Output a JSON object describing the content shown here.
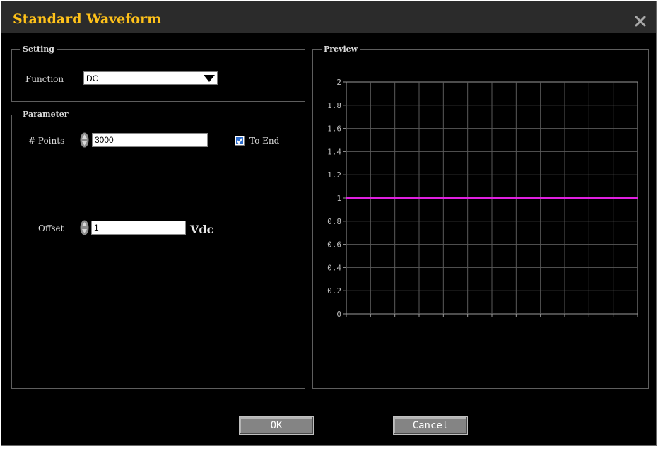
{
  "window": {
    "title": "Standard Waveform",
    "close_icon": "close-icon"
  },
  "setting": {
    "legend": "Setting",
    "function_label": "Function",
    "function_value": "DC"
  },
  "parameter": {
    "legend": "Parameter",
    "points_label": "# Points",
    "points_value": "3000",
    "to_end_label": "To End",
    "to_end_checked": true,
    "offset_label": "Offset",
    "offset_value": "1",
    "offset_unit": "Vdc"
  },
  "preview": {
    "legend": "Preview"
  },
  "buttons": {
    "ok": "OK",
    "cancel": "Cancel"
  },
  "colors": {
    "title": "#ffc21a",
    "waveform": "#e020e0",
    "grid": "#5a5a5a",
    "checkbox": "#2f6fd0"
  },
  "chart_data": {
    "type": "line",
    "title": "",
    "xlabel": "",
    "ylabel": "",
    "ylim": [
      0,
      2
    ],
    "yticks": [
      "0",
      "0.2",
      "0.4",
      "0.6",
      "0.8",
      "1",
      "1.2",
      "1.4",
      "1.6",
      "1.8",
      "2"
    ],
    "grid": true,
    "series": [
      {
        "values": [
          1,
          1
        ]
      }
    ]
  }
}
